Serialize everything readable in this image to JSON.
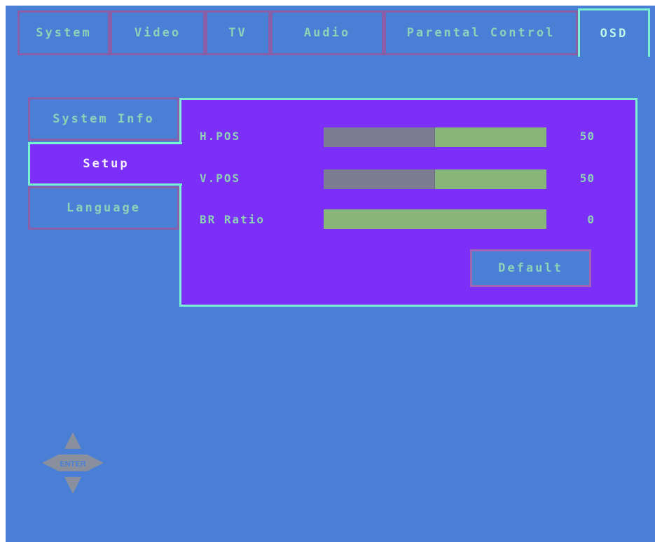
{
  "tabs": [
    {
      "label": "System"
    },
    {
      "label": "Video"
    },
    {
      "label": "TV"
    },
    {
      "label": "Audio"
    },
    {
      "label": "Parental Control"
    },
    {
      "label": "OSD"
    }
  ],
  "active_tab": "OSD",
  "side_menu": [
    {
      "label": "System Info"
    },
    {
      "label": "Setup"
    },
    {
      "label": "Language"
    }
  ],
  "active_side_item": "Setup",
  "settings": [
    {
      "label": "H.POS",
      "value": "50",
      "level_percent": 50
    },
    {
      "label": "V.POS",
      "value": "50",
      "level_percent": 50
    },
    {
      "label": "BR Ratio",
      "value": "0",
      "level_percent": 0
    }
  ],
  "default_button": {
    "label": "Default"
  },
  "enter_pad": {
    "label": "ENTER"
  },
  "colors": {
    "background": "#4a7fd6",
    "panel_purple": "#7b2ff7",
    "text_green": "#8fd0b8",
    "highlight_border": "#7af0d4",
    "tab_border": "#8a5fa8",
    "bar_track": "#88b57a",
    "bar_fill": "#7d7d92"
  }
}
